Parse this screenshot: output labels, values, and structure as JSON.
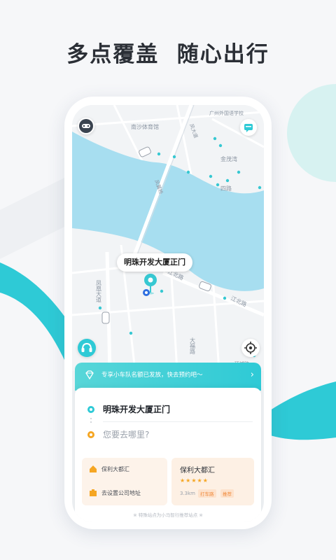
{
  "headline": "多点覆盖  随心出行",
  "map": {
    "labels": {
      "stadium": "南沙体育馆",
      "school": "广州外国语学校",
      "bridge_north": "凤大道",
      "bridge_mid": "凤翼桥",
      "jinmaowan": "金茂湾",
      "road_east": "四路",
      "jiangbei": "江北路",
      "jiangbei2": "江北路",
      "fenghuang": "凤凰大道",
      "dafu": "大福路",
      "bottom_right": "环城路"
    },
    "pin_label": "明珠开发大厦正门"
  },
  "promo": {
    "text": "专享小车队名额已发放，快去预约吧～",
    "arrow": "›"
  },
  "booking": {
    "from": "明珠开发大厦正门",
    "to_placeholder": "您要去哪里?",
    "shortcut_home": "保利大都汇",
    "shortcut_company": "去设置公司地址",
    "recommend": {
      "title": "保利大都汇",
      "rating": 5,
      "stars": "★★★★★",
      "distance": "3.3km",
      "tag1": "打车路",
      "tag2": "推荐"
    },
    "footer": "※ 特殊站点为小马智行推荐站点 ※"
  },
  "colors": {
    "accent": "#2ecad6",
    "water": "#a7def0",
    "pin": "#37c8d2",
    "orange": "#f5a623"
  }
}
